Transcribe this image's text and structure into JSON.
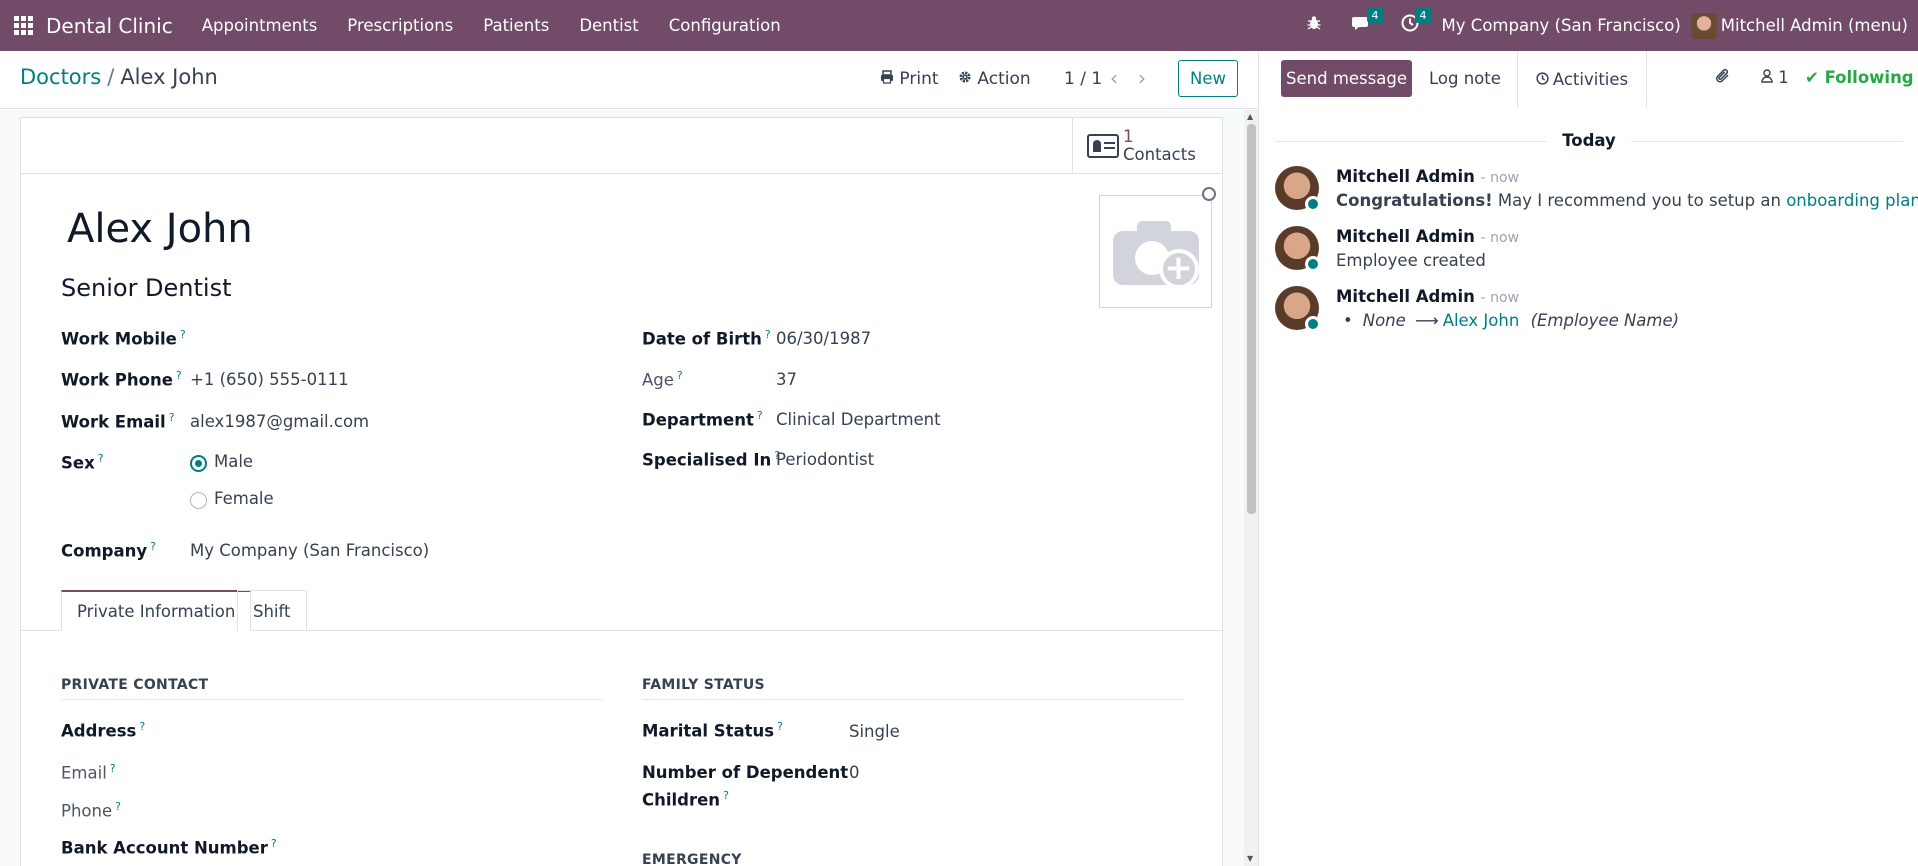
{
  "topbar": {
    "brand": "Dental Clinic",
    "menu": [
      "Appointments",
      "Prescriptions",
      "Patients",
      "Dentist",
      "Configuration"
    ],
    "messages_count": "4",
    "activities_count": "4",
    "company": "My Company (San Francisco)",
    "user": "Mitchell Admin (menu)",
    "colors": {
      "brand": "#714B67",
      "accent": "#017E84"
    }
  },
  "control_panel": {
    "breadcrumb_parent": "Doctors",
    "breadcrumb_sep": "/",
    "breadcrumb_current": "Alex John",
    "print_label": "Print",
    "action_label": "Action",
    "pager": "1 / 1",
    "new_label": "New"
  },
  "smart_button": {
    "value": "1",
    "label": "Contacts"
  },
  "employee": {
    "name": "Alex John",
    "job_title": "Senior Dentist"
  },
  "fields_left": {
    "work_mobile_label": "Work Mobile",
    "work_mobile": "",
    "work_phone_label": "Work Phone",
    "work_phone": "+1 (650) 555-0111",
    "work_email_label": "Work Email",
    "work_email": "alex1987@gmail.com",
    "sex_label": "Sex",
    "sex_options": [
      "Male",
      "Female"
    ],
    "sex_selected": "Male",
    "company_label": "Company",
    "company": "My Company (San Francisco)"
  },
  "fields_right": {
    "dob_label": "Date of Birth",
    "dob": "06/30/1987",
    "age_label": "Age",
    "age": "37",
    "department_label": "Department",
    "department": "Clinical Department",
    "specialised_label": "Specialised In",
    "specialised": "Periodontist"
  },
  "tabs": [
    "Private Information",
    "Shift"
  ],
  "private_contact": {
    "title": "PRIVATE CONTACT",
    "address_label": "Address",
    "email_label": "Email",
    "phone_label": "Phone",
    "bank_label": "Bank Account Number"
  },
  "family_status": {
    "title": "FAMILY STATUS",
    "marital_label": "Marital Status",
    "marital": "Single",
    "dependents_label_1": "Number of Dependent",
    "dependents_label_2": "Children",
    "dependents": "0",
    "emergency_title": "EMERGENCY"
  },
  "chatter": {
    "send_message": "Send message",
    "log_note": "Log note",
    "activities": "Activities",
    "followers_count": "1",
    "following": "Following",
    "today": "Today",
    "messages": [
      {
        "author": "Mitchell Admin",
        "date": "- now",
        "bold": "Congratulations!",
        "text": " May I recommend you to setup an ",
        "link": "onboarding plan?"
      },
      {
        "author": "Mitchell Admin",
        "date": "- now",
        "text": "Employee created"
      },
      {
        "author": "Mitchell Admin",
        "date": "- now",
        "old": "None",
        "arrow": "⟶",
        "new": "Alex John",
        "field": "(Employee Name)"
      }
    ]
  }
}
